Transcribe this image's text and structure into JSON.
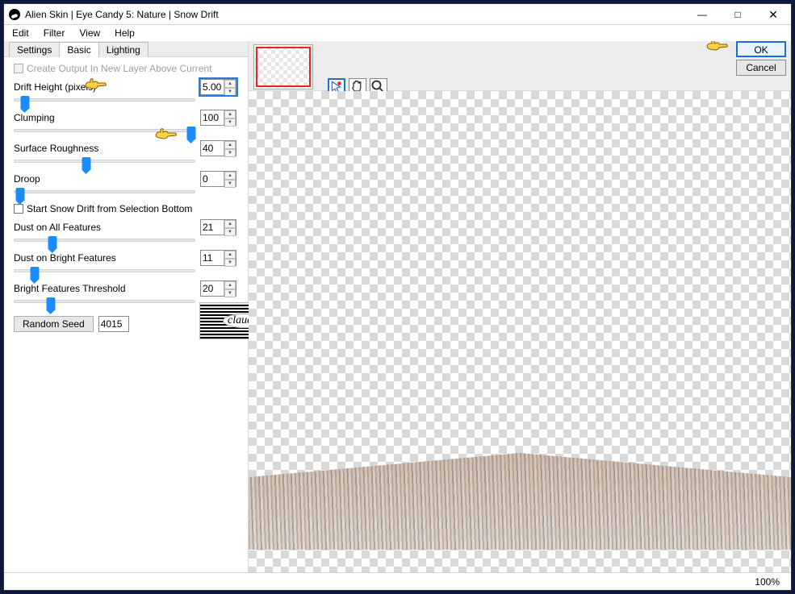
{
  "window": {
    "title": "Alien Skin | Eye Candy 5: Nature | Snow Drift"
  },
  "menubar": [
    "Edit",
    "Filter",
    "View",
    "Help"
  ],
  "tabs": [
    {
      "label": "Settings",
      "active": false
    },
    {
      "label": "Basic",
      "active": true
    },
    {
      "label": "Lighting",
      "active": false
    }
  ],
  "left_panel": {
    "create_output_label": "Create Output In New Layer Above Current",
    "create_output_checked": false,
    "create_output_enabled": false,
    "params": {
      "drift_height": {
        "label": "Drift Height (pixels)",
        "value": "5.00",
        "pos_pct": 6,
        "focused": true
      },
      "clumping": {
        "label": "Clumping",
        "value": "100",
        "pos_pct": 100
      },
      "roughness": {
        "label": "Surface Roughness",
        "value": "40",
        "pos_pct": 40
      },
      "droop": {
        "label": "Droop",
        "value": "0",
        "pos_pct": 3
      },
      "dust_all": {
        "label": "Dust on All Features",
        "value": "21",
        "pos_pct": 21
      },
      "dust_bright": {
        "label": "Dust on Bright Features",
        "value": "11",
        "pos_pct": 11
      },
      "bright_thresh": {
        "label": "Bright Features Threshold",
        "value": "20",
        "pos_pct": 20
      }
    },
    "start_from_bottom_label": "Start Snow Drift from Selection Bottom",
    "start_from_bottom_checked": false,
    "random_seed_label": "Random Seed",
    "random_seed_value": "4015"
  },
  "toolbar_icons": {
    "pointer": "pointer-tool-icon",
    "hand": "hand-tool-icon",
    "zoom": "zoom-tool-icon"
  },
  "watermark_text": "claudia",
  "actions": {
    "ok": "OK",
    "cancel": "Cancel"
  },
  "status": {
    "zoom": "100%"
  }
}
